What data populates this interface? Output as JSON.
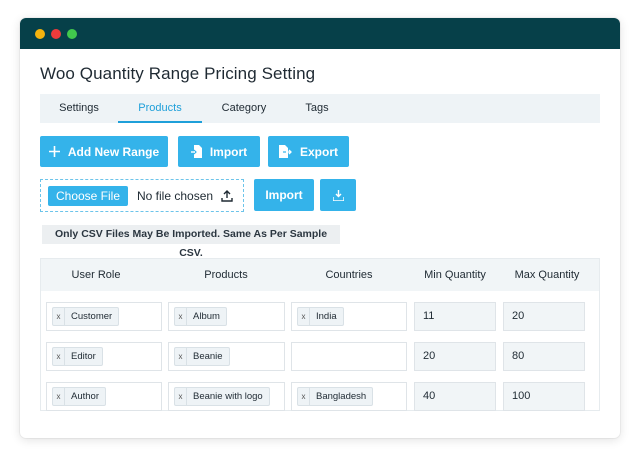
{
  "page": {
    "title": "Woo Quantity Range Pricing Setting"
  },
  "tabs": [
    {
      "label": "Settings",
      "active": false
    },
    {
      "label": "Products",
      "active": true
    },
    {
      "label": "Category",
      "active": false
    },
    {
      "label": "Tags",
      "active": false
    }
  ],
  "toolbar": {
    "add_label": "Add New Range",
    "import_label": "Import",
    "export_label": "Export"
  },
  "file_upload": {
    "choose_label": "Choose File",
    "status": "No file chosen",
    "import_label": "Import"
  },
  "notice": "Only CSV Files May Be Imported. Same As Per Sample CSV.",
  "table": {
    "headers": [
      "User Role",
      "Products",
      "Countries",
      "Min Quantity",
      "Max Quantity"
    ],
    "rows": [
      {
        "role": "Customer",
        "product": "Album",
        "country": "India",
        "min": "11",
        "max": "20"
      },
      {
        "role": "Editor",
        "product": "Beanie",
        "country": "",
        "min": "20",
        "max": "80"
      },
      {
        "role": "Author",
        "product": "Beanie with logo",
        "country": "Bangladesh",
        "min": "40",
        "max": "100"
      }
    ],
    "chip_remove": "x"
  },
  "colors": {
    "titlebar": "#064049",
    "accent": "#34b3ea",
    "tab_active": "#1e9fd9"
  },
  "icons": {
    "add": "plus-icon",
    "import": "file-import-icon",
    "export": "file-export-icon",
    "upload": "upload-icon",
    "download": "download-icon"
  }
}
